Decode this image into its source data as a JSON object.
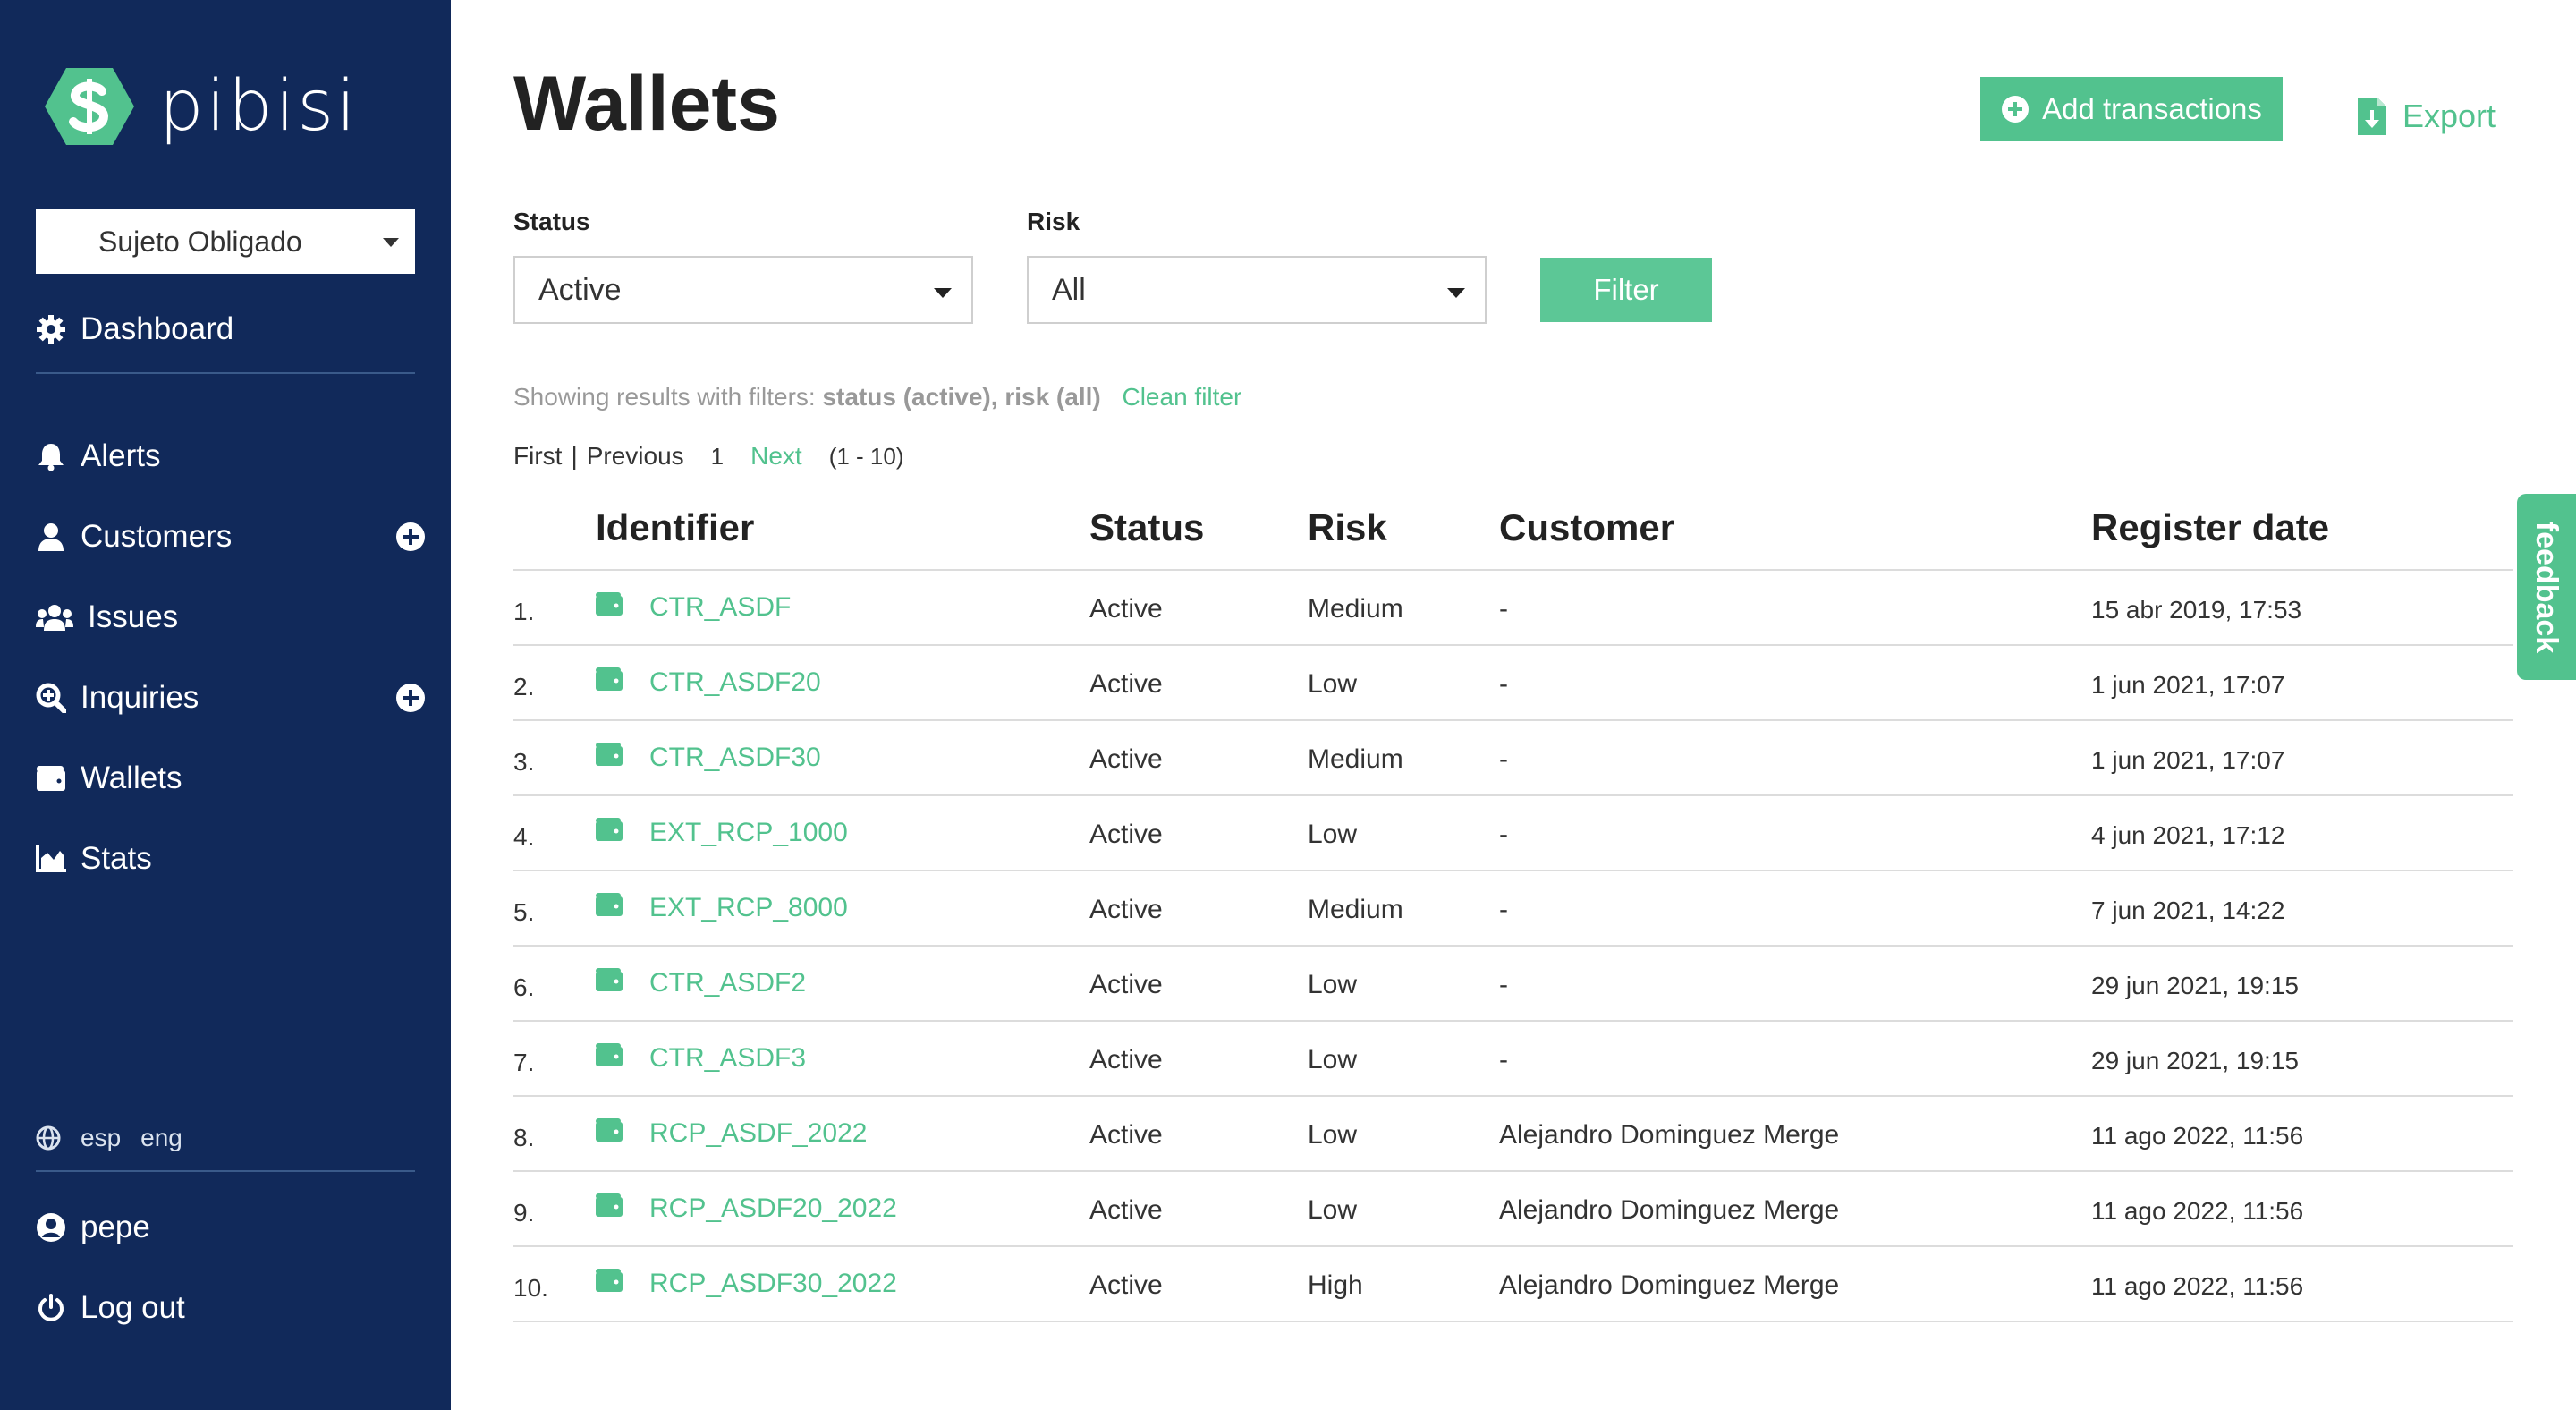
{
  "brand": {
    "name": "pibisi"
  },
  "sidebar": {
    "org_select": "Sujeto Obligado",
    "items": [
      {
        "label": "Dashboard",
        "icon": "gear-icon"
      },
      {
        "label": "Alerts",
        "icon": "bell-icon"
      },
      {
        "label": "Customers",
        "icon": "user-icon",
        "has_add": true
      },
      {
        "label": "Issues",
        "icon": "users-icon"
      },
      {
        "label": "Inquiries",
        "icon": "search-plus-icon",
        "has_add": true
      },
      {
        "label": "Wallets",
        "icon": "wallet-icon"
      },
      {
        "label": "Stats",
        "icon": "chart-area-icon"
      }
    ],
    "languages": [
      "esp",
      "eng"
    ],
    "user": "pepe",
    "logout": "Log out"
  },
  "header": {
    "title": "Wallets",
    "add_transactions": "Add transactions",
    "export": "Export"
  },
  "filters": {
    "status_label": "Status",
    "status_value": "Active",
    "risk_label": "Risk",
    "risk_value": "All",
    "filter_button": "Filter",
    "summary_prefix": "Showing results with filters:",
    "summary_filters": "status (active), risk (all)",
    "clean_filter": "Clean filter"
  },
  "pagination": {
    "first": "First",
    "separator": "|",
    "previous": "Previous",
    "current": "1",
    "next": "Next",
    "range": "(1 - 10)"
  },
  "table": {
    "columns": [
      "Identifier",
      "Status",
      "Risk",
      "Customer",
      "Register date"
    ],
    "rows": [
      {
        "n": "1.",
        "id": "CTR_ASDF",
        "status": "Active",
        "risk": "Medium",
        "customer": "-",
        "date": "15 abr 2019, 17:53"
      },
      {
        "n": "2.",
        "id": "CTR_ASDF20",
        "status": "Active",
        "risk": "Low",
        "customer": "-",
        "date": "1 jun 2021, 17:07"
      },
      {
        "n": "3.",
        "id": "CTR_ASDF30",
        "status": "Active",
        "risk": "Medium",
        "customer": "-",
        "date": "1 jun 2021, 17:07"
      },
      {
        "n": "4.",
        "id": "EXT_RCP_1000",
        "status": "Active",
        "risk": "Low",
        "customer": "-",
        "date": "4 jun 2021, 17:12"
      },
      {
        "n": "5.",
        "id": "EXT_RCP_8000",
        "status": "Active",
        "risk": "Medium",
        "customer": "-",
        "date": "7 jun 2021, 14:22"
      },
      {
        "n": "6.",
        "id": "CTR_ASDF2",
        "status": "Active",
        "risk": "Low",
        "customer": "-",
        "date": "29 jun 2021, 19:15"
      },
      {
        "n": "7.",
        "id": "CTR_ASDF3",
        "status": "Active",
        "risk": "Low",
        "customer": "-",
        "date": "29 jun 2021, 19:15"
      },
      {
        "n": "8.",
        "id": "RCP_ASDF_2022",
        "status": "Active",
        "risk": "Low",
        "customer": "Alejandro Dominguez Merge",
        "date": "11 ago 2022, 11:56"
      },
      {
        "n": "9.",
        "id": "RCP_ASDF20_2022",
        "status": "Active",
        "risk": "Low",
        "customer": "Alejandro Dominguez Merge",
        "date": "11 ago 2022, 11:56"
      },
      {
        "n": "10.",
        "id": "RCP_ASDF30_2022",
        "status": "Active",
        "risk": "High",
        "customer": "Alejandro Dominguez Merge",
        "date": "11 ago 2022, 11:56"
      }
    ]
  },
  "feedback": "feedback",
  "colors": {
    "sidebar": "#11295a",
    "accent": "#52c28e",
    "text": "#222222"
  }
}
